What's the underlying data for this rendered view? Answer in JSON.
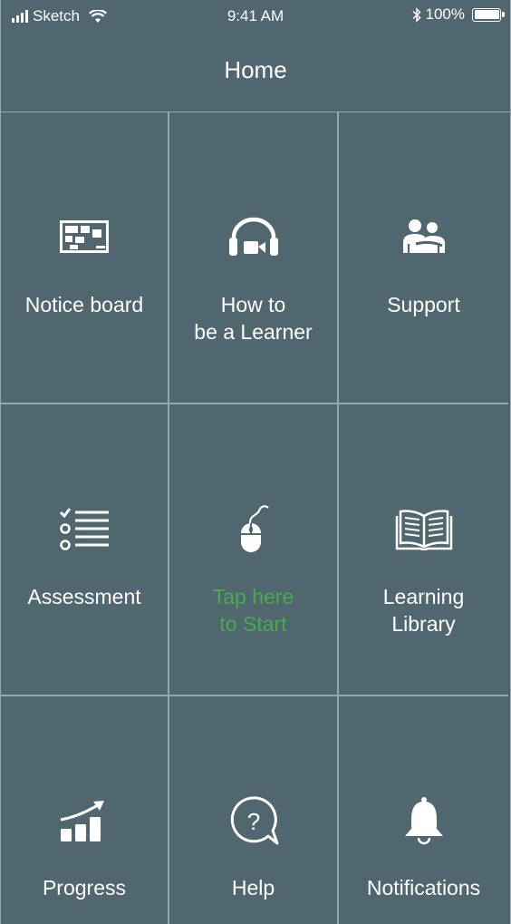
{
  "status_bar": {
    "carrier": "Sketch",
    "time": "9:41 AM",
    "battery": "100%"
  },
  "header": {
    "title": "Home"
  },
  "theme": {
    "background": "#506770",
    "divider": "#93a8b0",
    "accent": "#4aab4e"
  },
  "tiles": [
    {
      "label": "Notice board",
      "icon": "notice-board-icon"
    },
    {
      "label": "How to\nbe a Learner",
      "icon": "headset-video-icon"
    },
    {
      "label": "Support",
      "icon": "people-support-icon"
    },
    {
      "label": "Assessment",
      "icon": "checklist-icon"
    },
    {
      "label": "Tap here\nto Start",
      "icon": "mouse-icon"
    },
    {
      "label": "Learning\nLibrary",
      "icon": "open-book-icon"
    },
    {
      "label": "Progress",
      "icon": "progress-chart-icon"
    },
    {
      "label": "Help",
      "icon": "help-bubble-icon"
    },
    {
      "label": "Notifications",
      "icon": "bell-icon"
    }
  ]
}
